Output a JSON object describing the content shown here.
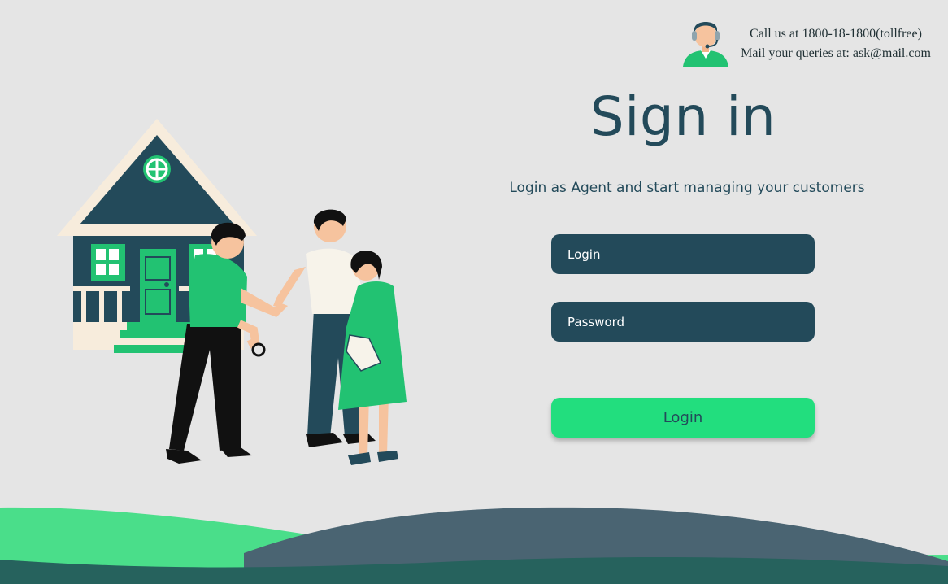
{
  "support": {
    "phone_text": "Call us at 1800-18-1800(tollfree)",
    "mail_text": "Mail your queries at: ask@mail.com",
    "icon": "support-agent-icon"
  },
  "page": {
    "title": "Sign in",
    "subtitle": "Login as Agent and start managing your customers"
  },
  "form": {
    "login_placeholder": "Login",
    "password_placeholder": "Password",
    "submit_label": "Login"
  },
  "illustration": {
    "name": "agent-handing-house-keys-to-couple"
  },
  "colors": {
    "background": "#e5e5e5",
    "primary_dark": "#234a5a",
    "accent_green": "#22de7e",
    "wave_light_green": "#4ade8a",
    "wave_slate": "#4a6472",
    "wave_deep": "#26625d"
  }
}
